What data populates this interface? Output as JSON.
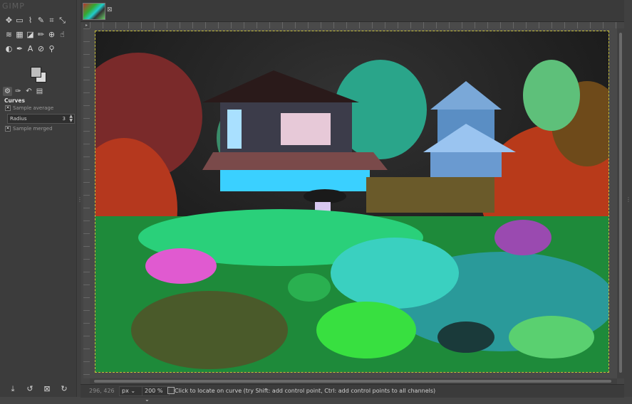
{
  "app": {
    "logo_text": "GIMP"
  },
  "toolbox": {
    "tools": [
      {
        "name": "move-tool-icon",
        "glyph": "✥"
      },
      {
        "name": "rect-select-icon",
        "glyph": "▭"
      },
      {
        "name": "lasso-icon",
        "glyph": "⌇"
      },
      {
        "name": "fuzzy-select-icon",
        "glyph": "✎"
      },
      {
        "name": "crop-icon",
        "glyph": "⌗"
      },
      {
        "name": "transform-icon",
        "glyph": "⤡"
      },
      {
        "name": "warp-icon",
        "glyph": "≋"
      },
      {
        "name": "cage-icon",
        "glyph": "▦"
      },
      {
        "name": "bucket-fill-icon",
        "glyph": "◪"
      },
      {
        "name": "paintbrush-icon",
        "glyph": "✏"
      },
      {
        "name": "clone-icon",
        "glyph": "⊕"
      },
      {
        "name": "smudge-icon",
        "glyph": "☝"
      },
      {
        "name": "dodge-icon",
        "glyph": "◐"
      },
      {
        "name": "path-icon",
        "glyph": "✒"
      },
      {
        "name": "text-icon",
        "glyph": "A"
      },
      {
        "name": "color-picker-icon",
        "glyph": "⊘"
      },
      {
        "name": "zoom-icon",
        "glyph": "⚲"
      }
    ]
  },
  "colors": {
    "foreground": "#bdbdbd",
    "background": "#dcdcdc"
  },
  "dock_tabs": [
    {
      "name": "tool-options-tab-icon",
      "glyph": "⚙"
    },
    {
      "name": "device-status-tab-icon",
      "glyph": "✑"
    },
    {
      "name": "undo-history-tab-icon",
      "glyph": "↶"
    },
    {
      "name": "images-tab-icon",
      "glyph": "▤"
    }
  ],
  "tool_options": {
    "title": "Curves",
    "sample_average_label": "Sample average",
    "radius_label": "Radius",
    "radius_value": "3",
    "sample_merged_label": "Sample merged"
  },
  "dock_bottom": [
    {
      "name": "save-options-icon",
      "glyph": "⤓"
    },
    {
      "name": "restore-options-icon",
      "glyph": "↺"
    },
    {
      "name": "delete-options-icon",
      "glyph": "⊠"
    },
    {
      "name": "reset-options-icon",
      "glyph": "↻"
    }
  ],
  "status": {
    "coords": "296, 426",
    "unit": "px",
    "zoom": "200 %",
    "message": "Click to locate on curve (try Shift: add control point, Ctrl: add control points to all channels)"
  }
}
